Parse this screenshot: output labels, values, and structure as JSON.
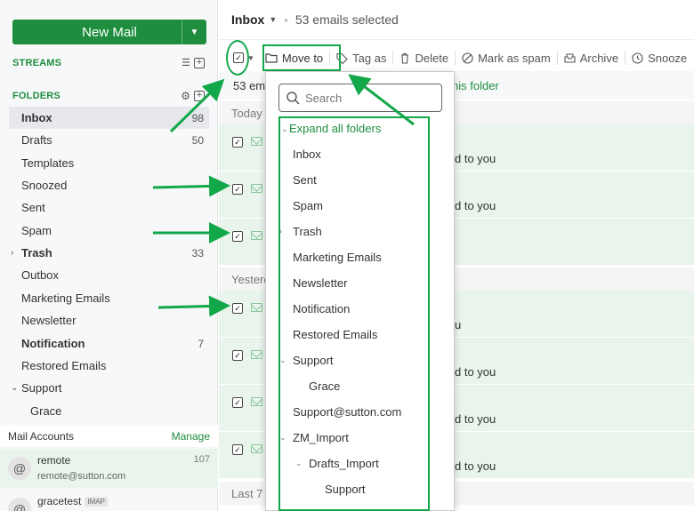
{
  "sidebar": {
    "new_mail_label": "New Mail",
    "streams_label": "STREAMS",
    "folders_label": "FOLDERS",
    "folders": [
      {
        "label": "Inbox",
        "count": "98",
        "active": true
      },
      {
        "label": "Drafts",
        "count": "50"
      },
      {
        "label": "Templates",
        "count": ""
      },
      {
        "label": "Snoozed",
        "count": ""
      },
      {
        "label": "Sent",
        "count": ""
      },
      {
        "label": "Spam",
        "count": ""
      },
      {
        "label": "Trash",
        "count": "33",
        "bold": true,
        "caret": "›"
      },
      {
        "label": "Outbox",
        "count": ""
      },
      {
        "label": "Marketing Emails",
        "count": ""
      },
      {
        "label": "Newsletter",
        "count": ""
      },
      {
        "label": "Notification",
        "count": "7",
        "bold": true
      },
      {
        "label": "Restored Emails",
        "count": ""
      },
      {
        "label": "Support",
        "count": "",
        "caret": "⌄"
      },
      {
        "label": "Grace",
        "count": "",
        "indent": true
      }
    ],
    "mail_accounts_label": "Mail Accounts",
    "manage_label": "Manage",
    "accounts": [
      {
        "name": "remote",
        "email": "remote@sutton.com",
        "count": "107"
      },
      {
        "name": "gracetest",
        "badge": "IMAP"
      }
    ]
  },
  "header": {
    "folder": "Inbox",
    "selection": "53 emails selected"
  },
  "toolbar": {
    "move_to": "Move to",
    "tag_as": "Tag as",
    "delete": "Delete",
    "mark_spam": "Mark as spam",
    "archive": "Archive",
    "snooze": "Snooze"
  },
  "mail": {
    "banner_start": "53 em",
    "banner_link": "his folder",
    "groups": {
      "today": "Today",
      "yesterday": "Yesterd",
      "last7": "Last 7"
    },
    "snippets": [
      "d to you",
      "d to you",
      "u",
      "d to you",
      "d to you",
      "d to you"
    ]
  },
  "dropdown": {
    "search_placeholder": "Search",
    "expand_all": "Expand all folders",
    "items": [
      "Inbox",
      "Sent",
      "Spam",
      "Trash",
      "Marketing Emails",
      "Newsletter",
      "Notification",
      "Restored Emails",
      "Support",
      "Grace",
      "Support@sutton.com",
      "ZM_Import",
      "Drafts_Import",
      "Support"
    ]
  },
  "colors": {
    "accent": "#1e8e3e",
    "annotation": "#12a84a",
    "selected_row": "#e9f5ec"
  }
}
